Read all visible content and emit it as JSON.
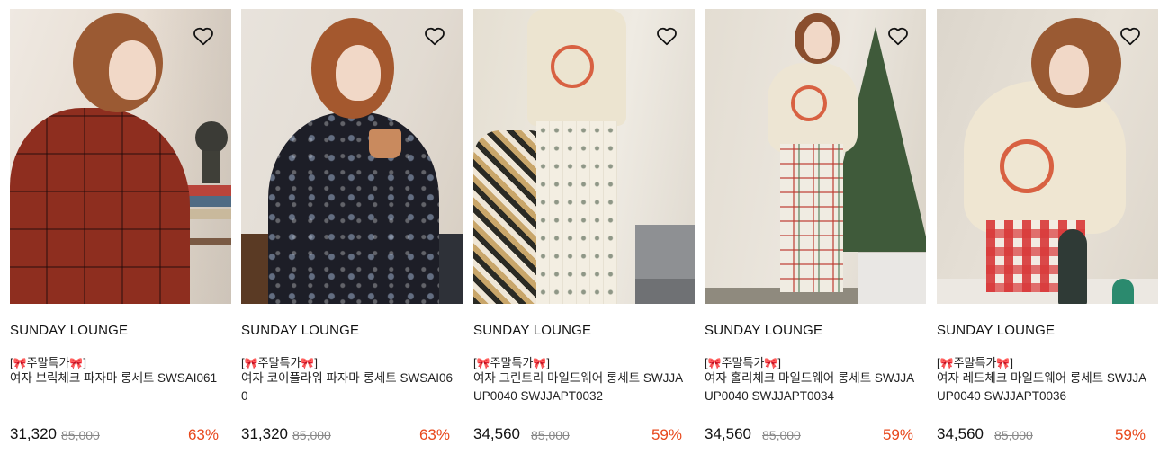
{
  "colors": {
    "discount": "#e8481c",
    "text": "#111111",
    "strike": "#888888"
  },
  "products": [
    {
      "brand": "SUNDAY LOUNGE",
      "tag_open": "[",
      "tag_text": "주말특가",
      "tag_close": "]",
      "bow": "🎀",
      "title": "여자 브릭체크 파자마 롱세트 SWSAI061",
      "price": "31,320",
      "original_price": "85,000",
      "discount": "63%"
    },
    {
      "brand": "SUNDAY LOUNGE",
      "tag_open": "[",
      "tag_text": "주말특가",
      "tag_close": "]",
      "bow": "🎀",
      "title": "여자 코이플라워 파자마 롱세트 SWSAI060",
      "price": "31,320",
      "original_price": "85,000",
      "discount": "63%"
    },
    {
      "brand": "SUNDAY LOUNGE",
      "tag_open": "[",
      "tag_text": "주말특가",
      "tag_close": "]",
      "bow": "🎀",
      "title": "여자 그린트리 마일드웨어 롱세트 SWJJAUP0040 SWJJAPT0032",
      "price": "34,560",
      "original_price": "85,000",
      "discount": "59%"
    },
    {
      "brand": "SUNDAY LOUNGE",
      "tag_open": "[",
      "tag_text": "주말특가",
      "tag_close": "]",
      "bow": "🎀",
      "title": "여자 홀리체크 마일드웨어 롱세트 SWJJAUP0040 SWJJAPT0034",
      "price": "34,560",
      "original_price": "85,000",
      "discount": "59%"
    },
    {
      "brand": "SUNDAY LOUNGE",
      "tag_open": "[",
      "tag_text": "주말특가",
      "tag_close": "]",
      "bow": "🎀",
      "title": "여자 레드체크 마일드웨어 롱세트 SWJJAUP0040 SWJJAPT0036",
      "price": "34,560",
      "original_price": "85,000",
      "discount": "59%"
    }
  ]
}
